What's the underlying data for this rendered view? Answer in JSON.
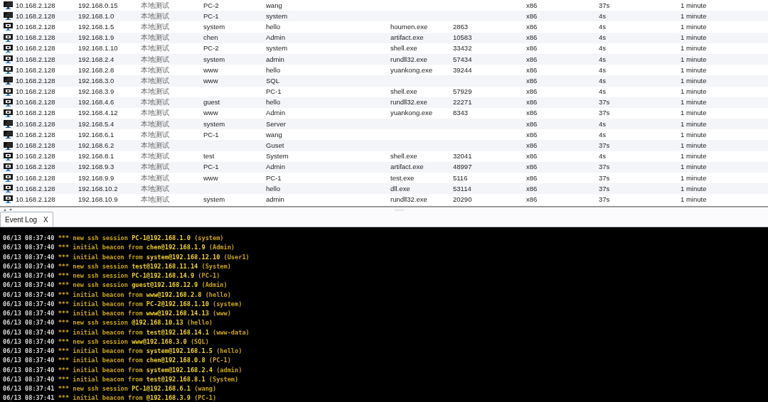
{
  "table": {
    "rows": [
      {
        "kind": "dark",
        "cells": [
          "10.168.2.128",
          "192.168.0.15",
          "本地测试",
          "PC-2",
          "wang",
          "",
          "",
          "x86",
          "37s",
          "1 minute"
        ]
      },
      {
        "kind": "dark",
        "cells": [
          "10.168.2.128",
          "192.168.1.0",
          "本地测试",
          "PC-1",
          "system",
          "",
          "",
          "x86",
          "4s",
          "1 minute"
        ]
      },
      {
        "kind": "framed",
        "cells": [
          "10.168.2.128",
          "192.168.1.5",
          "本地测试",
          "system",
          "hello",
          "houmen.exe",
          "2863",
          "x86",
          "4s",
          "1 minute"
        ]
      },
      {
        "kind": "framed",
        "cells": [
          "10.168.2.128",
          "192.168.1.9",
          "本地测试",
          "chen",
          "Admin",
          "artifact.exe",
          "10583",
          "x86",
          "4s",
          "1 minute"
        ]
      },
      {
        "kind": "framed",
        "cells": [
          "10.168.2.128",
          "192.168.1.10",
          "本地测试",
          "PC-2",
          "system",
          "shell.exe",
          "33432",
          "x86",
          "4s",
          "1 minute"
        ]
      },
      {
        "kind": "framed",
        "cells": [
          "10.168.2.128",
          "192.168.2.4",
          "本地测试",
          "system",
          "admin",
          "rundll32.exe",
          "57434",
          "x86",
          "4s",
          "1 minute"
        ]
      },
      {
        "kind": "framed",
        "cells": [
          "10.168.2.128",
          "192.168.2.8",
          "本地测试",
          "www",
          "hello",
          "yuankong.exe",
          "39244",
          "x86",
          "4s",
          "1 minute"
        ]
      },
      {
        "kind": "dark",
        "cells": [
          "10.168.2.128",
          "192.168.3.0",
          "本地测试",
          "www",
          "SQL",
          "",
          "",
          "x86",
          "4s",
          "1 minute"
        ]
      },
      {
        "kind": "framed",
        "cells": [
          "10.168.2.128",
          "192.168.3.9",
          "本地测试",
          "",
          "PC-1",
          "shell.exe",
          "57929",
          "x86",
          "4s",
          "1 minute"
        ]
      },
      {
        "kind": "framed",
        "cells": [
          "10.168.2.128",
          "192.168.4.6",
          "本地测试",
          "guest",
          "hello",
          "rundll32.exe",
          "22271",
          "x86",
          "37s",
          "1 minute"
        ]
      },
      {
        "kind": "framed",
        "cells": [
          "10.168.2.128",
          "192.168.4.12",
          "本地测试",
          "www",
          "Admin",
          "yuankong.exe",
          "8343",
          "x86",
          "37s",
          "1 minute"
        ]
      },
      {
        "kind": "dark",
        "cells": [
          "10.168.2.128",
          "192.168.5.4",
          "本地测试",
          "system",
          "Server",
          "",
          "",
          "x86",
          "4s",
          "1 minute"
        ]
      },
      {
        "kind": "dark",
        "cells": [
          "10.168.2.128",
          "192.168.6.1",
          "本地测试",
          "PC-1",
          "wang",
          "",
          "",
          "x86",
          "4s",
          "1 minute"
        ]
      },
      {
        "kind": "dark",
        "cells": [
          "10.168.2.128",
          "192.168.6.2",
          "本地测试",
          "",
          "Guset",
          "",
          "",
          "x86",
          "37s",
          "1 minute"
        ]
      },
      {
        "kind": "framed",
        "cells": [
          "10.168.2.128",
          "192.168.8.1",
          "本地测试",
          "test",
          "System",
          "shell.exe",
          "32041",
          "x86",
          "4s",
          "1 minute"
        ]
      },
      {
        "kind": "framed",
        "cells": [
          "10.168.2.128",
          "192.168.9.3",
          "本地测试",
          "PC-1",
          "Admin",
          "artifact.exe",
          "48997",
          "x86",
          "37s",
          "1 minute"
        ]
      },
      {
        "kind": "framed",
        "cells": [
          "10.168.2.128",
          "192.168.9.9",
          "本地测试",
          "www",
          "PC-1",
          "test.exe",
          "5116",
          "x86",
          "37s",
          "1 minute"
        ]
      },
      {
        "kind": "framed",
        "cells": [
          "10.168.2.128",
          "192.168.10.2",
          "本地测试",
          "",
          "hello",
          "dll.exe",
          "53114",
          "x86",
          "37s",
          "1 minute"
        ]
      },
      {
        "kind": "framed",
        "cells": [
          "10.168.2.128",
          "192.168.10.9",
          "本地测试",
          "system",
          "admin",
          "rundll32.exe",
          "20290",
          "x86",
          "37s",
          "1 minute"
        ]
      }
    ]
  },
  "tabs": [
    {
      "label": "Event Log",
      "close": "X",
      "selected": true
    }
  ],
  "event_log": [
    {
      "time": "06/13 08:37:40",
      "marker": "***",
      "event": "new ssh session",
      "target": "PC-1@192.168.1.0",
      "note": "(system)"
    },
    {
      "time": "06/13 08:37:40",
      "marker": "***",
      "event": "initial beacon from",
      "target": "chen@192.168.1.9",
      "note": "(Admin)"
    },
    {
      "time": "06/13 08:37:40",
      "marker": "***",
      "event": "initial beacon from",
      "target": "system@192.168.12.10",
      "note": "(User1)"
    },
    {
      "time": "06/13 08:37:40",
      "marker": "***",
      "event": "new ssh session",
      "target": "test@192.168.11.14",
      "note": "(System)"
    },
    {
      "time": "06/13 08:37:40",
      "marker": "***",
      "event": "new ssh session",
      "target": "PC-1@192.168.14.9",
      "note": "(PC-1)"
    },
    {
      "time": "06/13 08:37:40",
      "marker": "***",
      "event": "new ssh session",
      "target": "guest@192.168.12.9",
      "note": "(Admin)"
    },
    {
      "time": "06/13 08:37:40",
      "marker": "***",
      "event": "initial beacon from",
      "target": "www@192.168.2.8",
      "note": "(hello)"
    },
    {
      "time": "06/13 08:37:40",
      "marker": "***",
      "event": "initial beacon from",
      "target": "PC-2@192.168.1.10",
      "note": "(system)"
    },
    {
      "time": "06/13 08:37:40",
      "marker": "***",
      "event": "initial beacon from",
      "target": "www@192.168.14.13",
      "note": "(www)"
    },
    {
      "time": "06/13 08:37:40",
      "marker": "***",
      "event": "new ssh session",
      "target": "@192.168.10.13",
      "note": "(hello)"
    },
    {
      "time": "06/13 08:37:40",
      "marker": "***",
      "event": "initial beacon from",
      "target": "test@192.168.14.1",
      "note": "(www-data)"
    },
    {
      "time": "06/13 08:37:40",
      "marker": "***",
      "event": "new ssh session",
      "target": "www@192.168.3.0",
      "note": "(SQL)"
    },
    {
      "time": "06/13 08:37:40",
      "marker": "***",
      "event": "initial beacon from",
      "target": "system@192.168.1.5",
      "note": "(hello)"
    },
    {
      "time": "06/13 08:37:40",
      "marker": "***",
      "event": "initial beacon from",
      "target": "chen@192.168.0.8",
      "note": "(PC-1)"
    },
    {
      "time": "06/13 08:37:40",
      "marker": "***",
      "event": "initial beacon from",
      "target": "system@192.168.2.4",
      "note": "(admin)"
    },
    {
      "time": "06/13 08:37:40",
      "marker": "***",
      "event": "initial beacon from",
      "target": "test@192.168.8.1",
      "note": "(System)"
    },
    {
      "time": "06/13 08:37:41",
      "marker": "***",
      "event": "new ssh session",
      "target": "PC-1@192.168.6.1",
      "note": "(wang)"
    },
    {
      "time": "06/13 08:37:41",
      "marker": "***",
      "event": "initial beacon from",
      "target": "@192.168.3.9",
      "note": "(PC-1)"
    }
  ]
}
